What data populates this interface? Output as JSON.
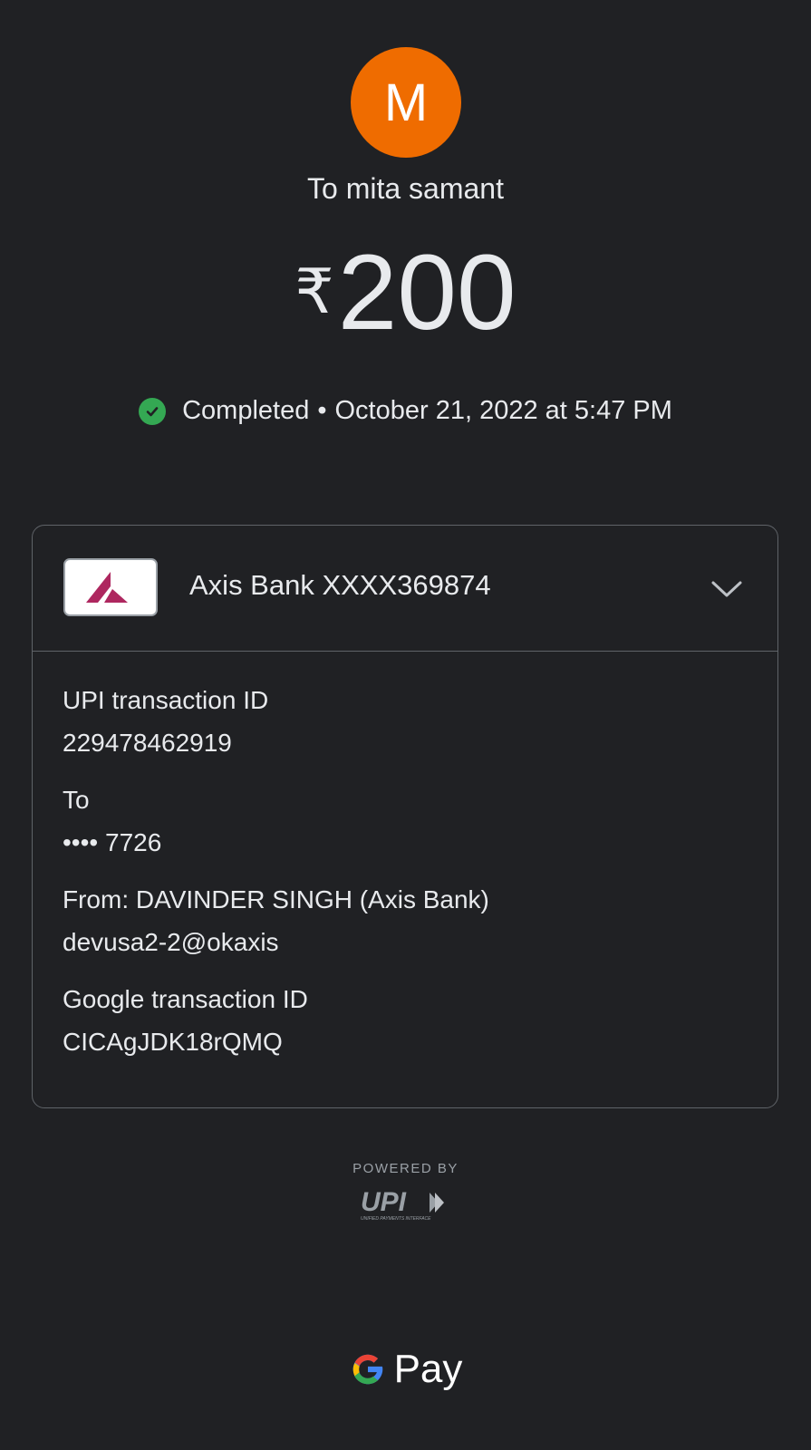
{
  "recipient": {
    "initial": "M",
    "avatar_color": "#ef6c00",
    "label": "To mita samant"
  },
  "payment": {
    "currency_symbol": "₹",
    "amount": "200",
    "status": "Completed",
    "separator": "•",
    "datetime": "October 21, 2022 at 5:47 PM",
    "status_icon": "check-circle-icon",
    "status_color": "#34a853"
  },
  "account": {
    "bank_name": "Axis Bank XXXX369874",
    "bank_logo": "axis-bank-logo",
    "expand_icon": "chevron-down-icon"
  },
  "details": [
    {
      "label": "UPI transaction ID",
      "value": "229478462919"
    },
    {
      "label": "To",
      "value": "•••• 7726"
    },
    {
      "label": "From: DAVINDER  SINGH (Axis Bank)",
      "value": "devusa2-2@okaxis"
    },
    {
      "label": "Google transaction ID",
      "value": "CICAgJDK18rQMQ"
    }
  ],
  "footer": {
    "powered_by": "POWERED BY",
    "upi_logo": "UPI",
    "upi_tagline": "UNIFIED PAYMENTS INTERFACE",
    "gpay_label": "Pay"
  }
}
